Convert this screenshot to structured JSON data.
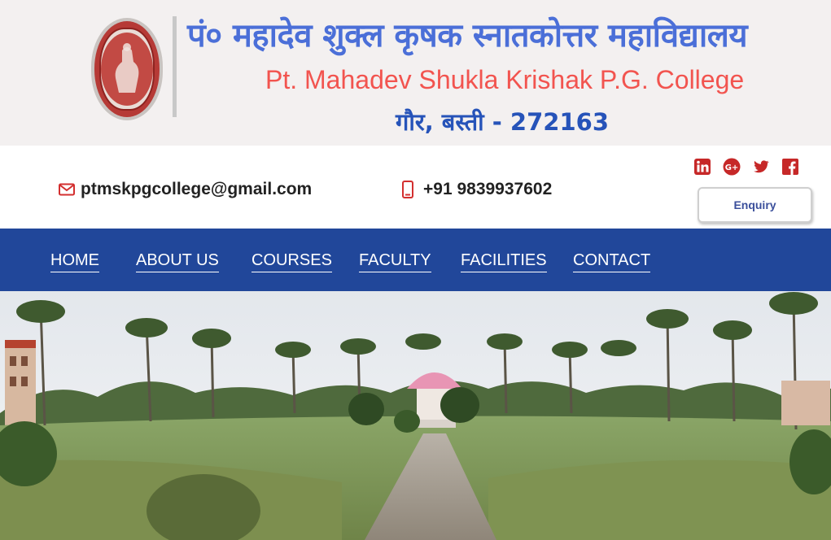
{
  "header": {
    "title_hindi": "पं० महादेव शुक्ल कृषक स्नातकोत्तर महाविद्यालय",
    "title_english": "Pt. Mahadev Shukla Krishak P.G. College",
    "location": "गौर, बस्ती - 272163",
    "seal_icon": "college-seal-logo"
  },
  "contact": {
    "email": "ptmskpgcollege@gmail.com",
    "email_icon": "envelope-icon",
    "phone": "+91 9839937602",
    "phone_icon": "mobile-phone-icon",
    "enquiry_label": "Enquiry",
    "socials": [
      "linkedin-icon",
      "google-plus-icon",
      "twitter-icon",
      "facebook-icon"
    ]
  },
  "nav": {
    "items": [
      "HOME",
      "ABOUT US",
      "COURSES",
      "FACULTY",
      "FACILITIES",
      "CONTACT"
    ]
  },
  "colors": {
    "nav_bg": "#21479a",
    "hindi_title": "#4b6fd8",
    "english_title": "#f2544f",
    "location": "#2653b9",
    "social_icons": "#c62828"
  },
  "hero": {
    "image": "campus-panorama-photo"
  }
}
